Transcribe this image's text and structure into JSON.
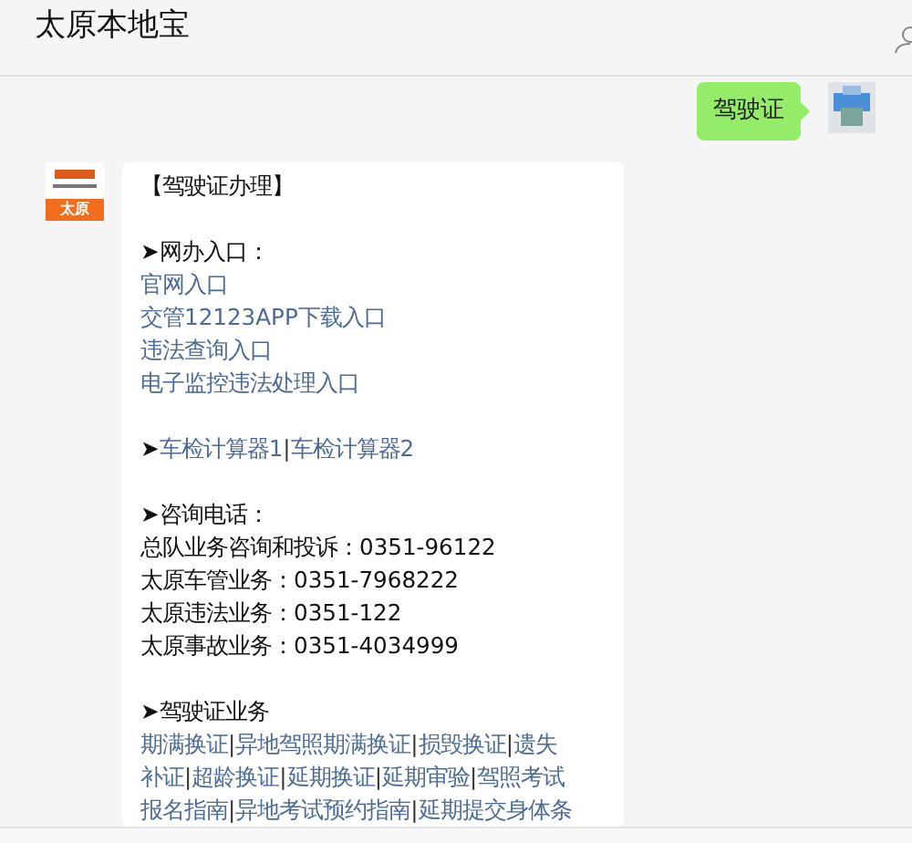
{
  "header": {
    "title": "太原本地宝"
  },
  "messages": [
    {
      "kind": "sent",
      "text": "驾驶证"
    },
    {
      "kind": "received",
      "logo_text": "太原",
      "lines": [
        {
          "kind": "text",
          "text": "【驾驶证办理】"
        },
        {
          "kind": "blank"
        },
        {
          "kind": "heading",
          "arrow": "➤",
          "text": "网办入口："
        },
        {
          "kind": "links",
          "items": [
            "官网入口"
          ]
        },
        {
          "kind": "links",
          "items": [
            "交管12123APP下载入口"
          ]
        },
        {
          "kind": "links",
          "items": [
            "违法查询入口"
          ]
        },
        {
          "kind": "links",
          "items": [
            "电子监控违法处理入口"
          ]
        },
        {
          "kind": "blank"
        },
        {
          "kind": "arrow-links",
          "arrow": "➤",
          "items": [
            "车检计算器1",
            "车检计算器2"
          ]
        },
        {
          "kind": "blank"
        },
        {
          "kind": "heading",
          "arrow": "➤",
          "text": "咨询电话："
        },
        {
          "kind": "text",
          "text": "总队业务咨询和投诉：0351-96122"
        },
        {
          "kind": "text",
          "text": "太原车管业务：0351-7968222"
        },
        {
          "kind": "text",
          "text": "太原违法业务：0351-122"
        },
        {
          "kind": "text",
          "text": "太原事故业务：0351-4034999"
        },
        {
          "kind": "blank"
        },
        {
          "kind": "heading",
          "arrow": "➤",
          "text": "驾驶证业务"
        },
        {
          "kind": "links",
          "items": [
            "期满换证",
            "异地驾照期满换证",
            "损毁换证",
            "遗失"
          ]
        },
        {
          "kind": "links",
          "items": [
            "补证",
            "超龄换证",
            "延期换证",
            "延期审验",
            "驾照考试"
          ]
        },
        {
          "kind": "links",
          "items": [
            "报名指南",
            "异地考试预约指南",
            "延期提交身体条"
          ]
        }
      ]
    }
  ],
  "separator": "|"
}
